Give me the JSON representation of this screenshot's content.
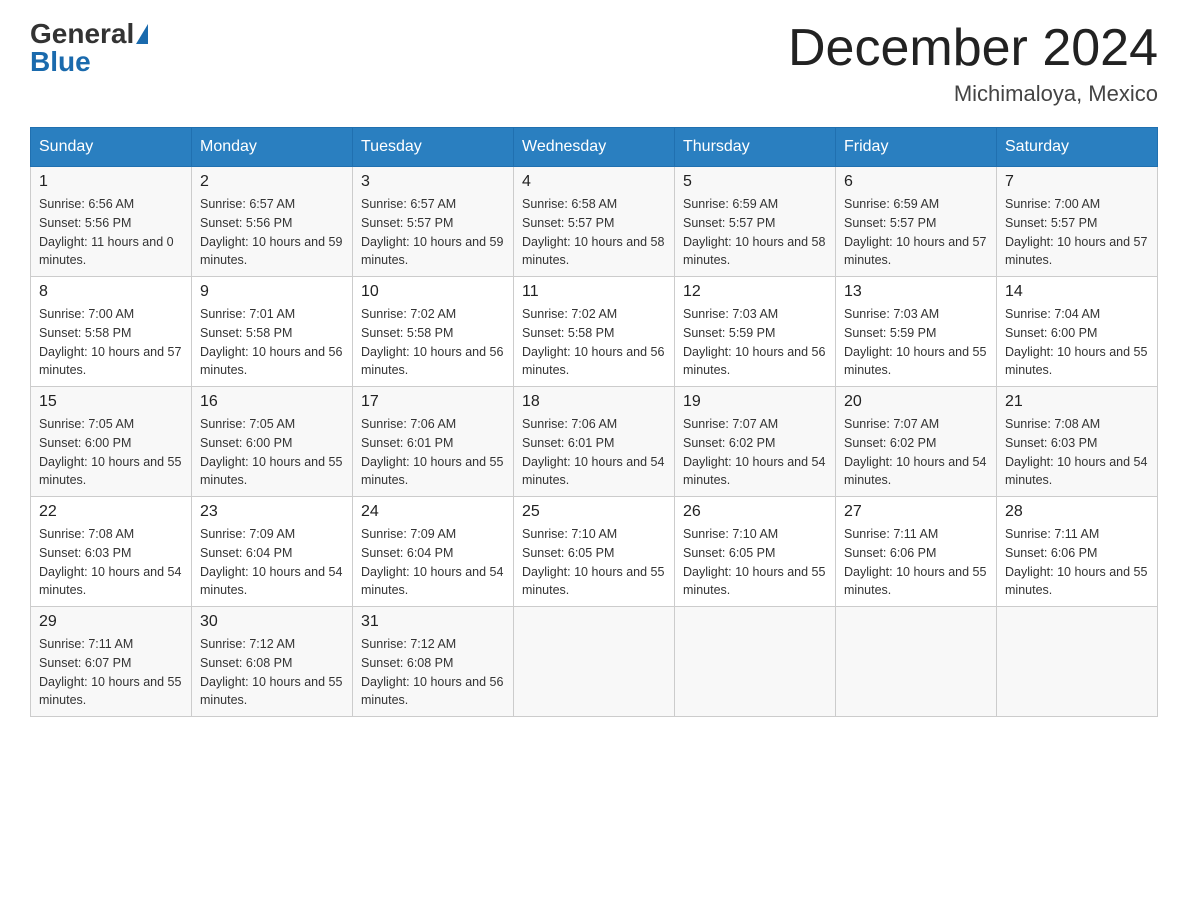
{
  "header": {
    "logo_general": "General",
    "logo_blue": "Blue",
    "month_title": "December 2024",
    "location": "Michimaloya, Mexico"
  },
  "days_of_week": [
    "Sunday",
    "Monday",
    "Tuesday",
    "Wednesday",
    "Thursday",
    "Friday",
    "Saturday"
  ],
  "weeks": [
    [
      {
        "day": "1",
        "sunrise": "6:56 AM",
        "sunset": "5:56 PM",
        "daylight": "11 hours and 0 minutes."
      },
      {
        "day": "2",
        "sunrise": "6:57 AM",
        "sunset": "5:56 PM",
        "daylight": "10 hours and 59 minutes."
      },
      {
        "day": "3",
        "sunrise": "6:57 AM",
        "sunset": "5:57 PM",
        "daylight": "10 hours and 59 minutes."
      },
      {
        "day": "4",
        "sunrise": "6:58 AM",
        "sunset": "5:57 PM",
        "daylight": "10 hours and 58 minutes."
      },
      {
        "day": "5",
        "sunrise": "6:59 AM",
        "sunset": "5:57 PM",
        "daylight": "10 hours and 58 minutes."
      },
      {
        "day": "6",
        "sunrise": "6:59 AM",
        "sunset": "5:57 PM",
        "daylight": "10 hours and 57 minutes."
      },
      {
        "day": "7",
        "sunrise": "7:00 AM",
        "sunset": "5:57 PM",
        "daylight": "10 hours and 57 minutes."
      }
    ],
    [
      {
        "day": "8",
        "sunrise": "7:00 AM",
        "sunset": "5:58 PM",
        "daylight": "10 hours and 57 minutes."
      },
      {
        "day": "9",
        "sunrise": "7:01 AM",
        "sunset": "5:58 PM",
        "daylight": "10 hours and 56 minutes."
      },
      {
        "day": "10",
        "sunrise": "7:02 AM",
        "sunset": "5:58 PM",
        "daylight": "10 hours and 56 minutes."
      },
      {
        "day": "11",
        "sunrise": "7:02 AM",
        "sunset": "5:58 PM",
        "daylight": "10 hours and 56 minutes."
      },
      {
        "day": "12",
        "sunrise": "7:03 AM",
        "sunset": "5:59 PM",
        "daylight": "10 hours and 56 minutes."
      },
      {
        "day": "13",
        "sunrise": "7:03 AM",
        "sunset": "5:59 PM",
        "daylight": "10 hours and 55 minutes."
      },
      {
        "day": "14",
        "sunrise": "7:04 AM",
        "sunset": "6:00 PM",
        "daylight": "10 hours and 55 minutes."
      }
    ],
    [
      {
        "day": "15",
        "sunrise": "7:05 AM",
        "sunset": "6:00 PM",
        "daylight": "10 hours and 55 minutes."
      },
      {
        "day": "16",
        "sunrise": "7:05 AM",
        "sunset": "6:00 PM",
        "daylight": "10 hours and 55 minutes."
      },
      {
        "day": "17",
        "sunrise": "7:06 AM",
        "sunset": "6:01 PM",
        "daylight": "10 hours and 55 minutes."
      },
      {
        "day": "18",
        "sunrise": "7:06 AM",
        "sunset": "6:01 PM",
        "daylight": "10 hours and 54 minutes."
      },
      {
        "day": "19",
        "sunrise": "7:07 AM",
        "sunset": "6:02 PM",
        "daylight": "10 hours and 54 minutes."
      },
      {
        "day": "20",
        "sunrise": "7:07 AM",
        "sunset": "6:02 PM",
        "daylight": "10 hours and 54 minutes."
      },
      {
        "day": "21",
        "sunrise": "7:08 AM",
        "sunset": "6:03 PM",
        "daylight": "10 hours and 54 minutes."
      }
    ],
    [
      {
        "day": "22",
        "sunrise": "7:08 AM",
        "sunset": "6:03 PM",
        "daylight": "10 hours and 54 minutes."
      },
      {
        "day": "23",
        "sunrise": "7:09 AM",
        "sunset": "6:04 PM",
        "daylight": "10 hours and 54 minutes."
      },
      {
        "day": "24",
        "sunrise": "7:09 AM",
        "sunset": "6:04 PM",
        "daylight": "10 hours and 54 minutes."
      },
      {
        "day": "25",
        "sunrise": "7:10 AM",
        "sunset": "6:05 PM",
        "daylight": "10 hours and 55 minutes."
      },
      {
        "day": "26",
        "sunrise": "7:10 AM",
        "sunset": "6:05 PM",
        "daylight": "10 hours and 55 minutes."
      },
      {
        "day": "27",
        "sunrise": "7:11 AM",
        "sunset": "6:06 PM",
        "daylight": "10 hours and 55 minutes."
      },
      {
        "day": "28",
        "sunrise": "7:11 AM",
        "sunset": "6:06 PM",
        "daylight": "10 hours and 55 minutes."
      }
    ],
    [
      {
        "day": "29",
        "sunrise": "7:11 AM",
        "sunset": "6:07 PM",
        "daylight": "10 hours and 55 minutes."
      },
      {
        "day": "30",
        "sunrise": "7:12 AM",
        "sunset": "6:08 PM",
        "daylight": "10 hours and 55 minutes."
      },
      {
        "day": "31",
        "sunrise": "7:12 AM",
        "sunset": "6:08 PM",
        "daylight": "10 hours and 56 minutes."
      },
      null,
      null,
      null,
      null
    ]
  ]
}
